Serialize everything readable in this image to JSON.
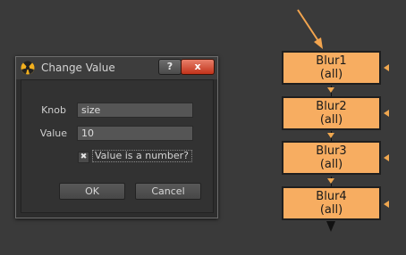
{
  "dialog": {
    "title": "Change Value",
    "help_button": "?",
    "close_button": "x",
    "knob_label": "Knob",
    "knob_value": "size",
    "value_label": "Value",
    "value_value": "10",
    "checkbox_label": "Value is a number?",
    "checkbox_checked": true,
    "ok_button": "OK",
    "cancel_button": "Cancel"
  },
  "graph": {
    "nodes": [
      {
        "name": "Blur1",
        "channels": "(all)"
      },
      {
        "name": "Blur2",
        "channels": "(all)"
      },
      {
        "name": "Blur3",
        "channels": "(all)"
      },
      {
        "name": "Blur4",
        "channels": "(all)"
      }
    ],
    "colors": {
      "node_fill": "#f7ad61",
      "pointer_arrow": "#f2a44e",
      "background": "#3a3a3a"
    }
  }
}
